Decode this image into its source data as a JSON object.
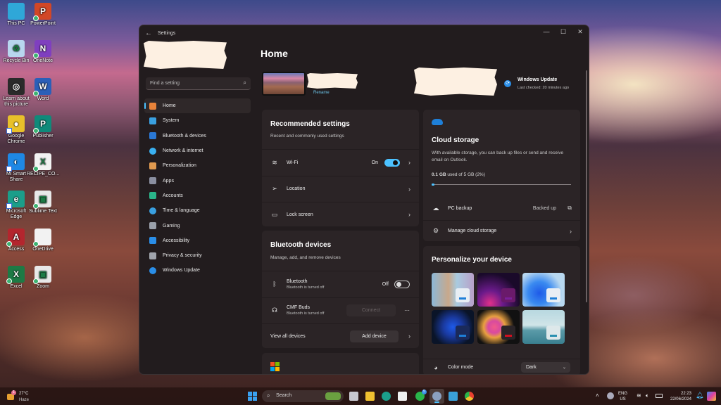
{
  "desktop": {
    "icons": [
      {
        "label": "This PC",
        "color": "#2fa7d8",
        "glyph": ""
      },
      {
        "label": "PowerPoint",
        "color": "#d24726",
        "glyph": "P"
      },
      {
        "label": "Recycle Bin",
        "color": "#b8d6ee",
        "glyph": "♻"
      },
      {
        "label": "OneNote",
        "color": "#7f3fbf",
        "glyph": "N"
      },
      {
        "label": "Learn about this picture",
        "color": "#2a2a2a",
        "glyph": "◎"
      },
      {
        "label": "Word",
        "color": "#2b5fb8",
        "glyph": "W"
      },
      {
        "label": "Google Chrome",
        "color": "#e8c02a",
        "glyph": "●"
      },
      {
        "label": "Publisher",
        "color": "#0f8a7a",
        "glyph": "P"
      },
      {
        "label": "Mi Smart Share",
        "color": "#1e88e5",
        "glyph": "◐"
      },
      {
        "label": "RECIPE_CO...",
        "color": "#f2f2f2",
        "glyph": "X"
      },
      {
        "label": "Microsoft Edge",
        "color": "#1b9e8a",
        "glyph": "e"
      },
      {
        "label": "Sublime Text",
        "color": "#e8e8e8",
        "glyph": "▣"
      },
      {
        "label": "Access",
        "color": "#b3262e",
        "glyph": "A"
      },
      {
        "label": "OneDrive",
        "color": "#f2f2f2",
        "glyph": ""
      },
      {
        "label": "Excel",
        "color": "#1d7a45",
        "glyph": "X"
      },
      {
        "label": "Zoom",
        "color": "#e8e8e8",
        "glyph": "▣"
      }
    ]
  },
  "window": {
    "title": "Settings",
    "back_icon": "←",
    "controls": {
      "minimize": "—",
      "maximize": "☐",
      "close": "✕"
    }
  },
  "sidebar": {
    "search_placeholder": "Find a setting",
    "search_icon": "⌕",
    "items": [
      {
        "label": "Home",
        "icon": "home-icon",
        "color": "#e8833a",
        "active": true
      },
      {
        "label": "System",
        "icon": "system-icon",
        "color": "#3aa0e0"
      },
      {
        "label": "Bluetooth & devices",
        "icon": "bluetooth-icon",
        "color": "#2a78d6"
      },
      {
        "label": "Network & internet",
        "icon": "network-icon",
        "color": "#3ab0f0"
      },
      {
        "label": "Personalization",
        "icon": "brush-icon",
        "color": "#e09a50"
      },
      {
        "label": "Apps",
        "icon": "apps-icon",
        "color": "#8a8fa0"
      },
      {
        "label": "Accounts",
        "icon": "accounts-icon",
        "color": "#2ab58a"
      },
      {
        "label": "Time & language",
        "icon": "clock-icon",
        "color": "#3aa0e0"
      },
      {
        "label": "Gaming",
        "icon": "gamepad-icon",
        "color": "#9aa0aa"
      },
      {
        "label": "Accessibility",
        "icon": "accessibility-icon",
        "color": "#2a8ee8"
      },
      {
        "label": "Privacy & security",
        "icon": "shield-icon",
        "color": "#a0a4ac"
      },
      {
        "label": "Windows Update",
        "icon": "update-icon",
        "color": "#2a8ee8"
      }
    ]
  },
  "home": {
    "title": "Home",
    "rename_label": "Rename",
    "windows_update": {
      "title": "Windows Update",
      "subtitle": "Last checked: 20 minutes ago"
    },
    "recommended": {
      "title": "Recommended settings",
      "subtitle": "Recent and commonly used settings",
      "rows": [
        {
          "label": "Wi-Fi",
          "icon": "wifi-icon",
          "state": "On"
        },
        {
          "label": "Location",
          "icon": "location-icon"
        },
        {
          "label": "Lock screen",
          "icon": "lock-screen-icon"
        }
      ]
    },
    "bluetooth": {
      "title": "Bluetooth devices",
      "subtitle": "Manage, add, and remove devices",
      "bt_label": "Bluetooth",
      "bt_sub": "Bluetooth is turned off",
      "bt_state": "Off",
      "device_name": "CMF Buds",
      "device_sub": "Bluetooth is turned off",
      "connect_label": "Connect",
      "more_label": "···",
      "view_all": "View all devices",
      "add_device": "Add device"
    },
    "cloud": {
      "title": "Cloud storage",
      "description": "With available storage, you can back up files or send and receive email on Outlook.",
      "used": "0.1 GB",
      "usage_text": "used of 5 GB (2%)",
      "used_fraction": 0.02,
      "pc_backup_label": "PC backup",
      "pc_backup_state": "Backed up",
      "manage_label": "Manage cloud storage"
    },
    "personalize": {
      "title": "Personalize your device",
      "themes": [
        {
          "name": "theme-1",
          "accent": "#1e7fd8"
        },
        {
          "name": "theme-2",
          "accent": "#7a1f9a"
        },
        {
          "name": "theme-3",
          "accent": "#1e7fd8"
        },
        {
          "name": "theme-4",
          "accent": "#1e7fd8"
        },
        {
          "name": "theme-5",
          "accent": "#d01020"
        },
        {
          "name": "theme-6",
          "accent": "#2a90b0"
        }
      ],
      "color_mode_label": "Color mode",
      "color_mode_value": "Dark"
    }
  },
  "taskbar": {
    "weather_temp": "27°C",
    "weather_desc": "Haze",
    "weather_badge": "1",
    "search_label": "Search",
    "whatsapp_badge": "5",
    "lang_top": "ENG",
    "lang_bottom": "US",
    "time": "22:23",
    "date": "22/06/2024"
  }
}
